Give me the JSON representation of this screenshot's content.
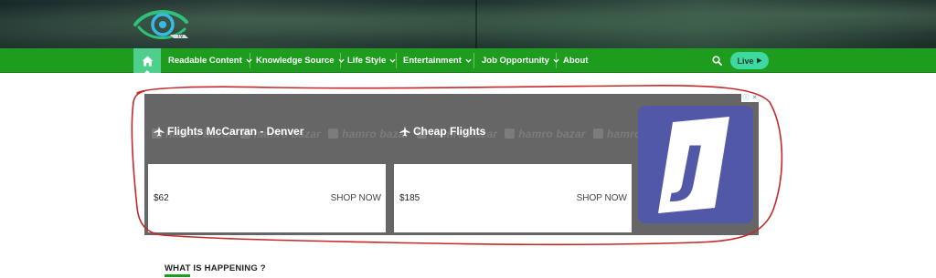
{
  "header": {
    "logo_icon": "eye-logo-icon"
  },
  "nav": {
    "home_icon": "home-icon",
    "items": [
      {
        "label": "Readable Content",
        "has_dropdown": true
      },
      {
        "label": "Knowledge Source",
        "has_dropdown": true
      },
      {
        "label": "Life Style",
        "has_dropdown": true
      },
      {
        "label": "Entertainment",
        "has_dropdown": true
      },
      {
        "label": "Job Opportunity",
        "has_dropdown": true
      },
      {
        "label": "About",
        "has_dropdown": false
      }
    ],
    "search_icon": "search-icon",
    "live_label": "Live",
    "live_icon": "play-icon",
    "colors": {
      "bar": "#1e9c1e",
      "home_bg": "#4fcf8c",
      "live_bg": "#3ed9a0"
    }
  },
  "ad": {
    "watermark_text": "hamro bazar",
    "titles": [
      {
        "icon": "plane-icon",
        "text": "Flights McCarran - Denver"
      },
      {
        "icon": "plane-icon",
        "text": "Cheap Flights"
      }
    ],
    "cards": [
      {
        "price": "$62",
        "action": "SHOP NOW"
      },
      {
        "price": "$185",
        "action": "SHOP NOW"
      }
    ],
    "brand_letter": "J",
    "ad_choices_icons": [
      "info-icon",
      "close-icon"
    ],
    "colors": {
      "background": "#666666",
      "brand": "#5258a8",
      "annotation": "#c62828"
    }
  },
  "section": {
    "heading": "WHAT IS HAPPENING ?"
  }
}
